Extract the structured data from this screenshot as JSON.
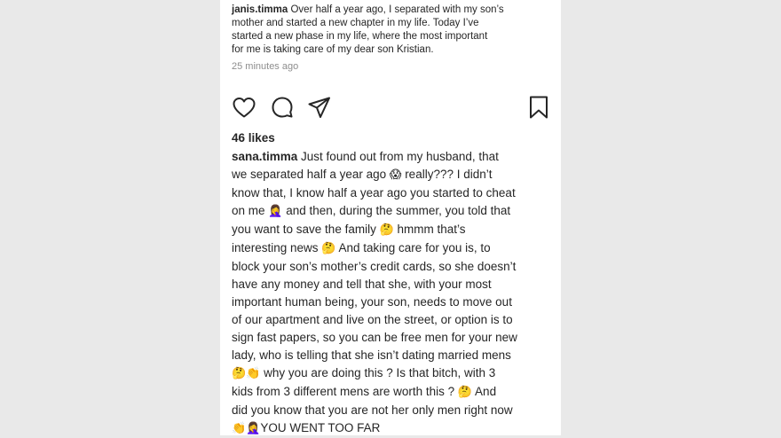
{
  "post": {
    "caption": {
      "username": "janis.timma",
      "text_lines": [
        "Over half a year ago, I separated with my son’s",
        "mother and started a new chapter in my life. Today I’ve",
        "started a new phase in my life, where the most important",
        "for me is taking care of my dear son Kristian."
      ],
      "timestamp": "25 minutes ago"
    },
    "actions": {
      "icons": [
        "heart-icon",
        "comment-icon",
        "share-icon",
        "bookmark-icon"
      ]
    },
    "likes": "46 likes",
    "comment": {
      "username": "sana.timma",
      "lines": [
        {
          "parts": [
            " Just found out from my husband, that"
          ]
        },
        {
          "parts": [
            "we separated half a year ago ",
            "😱",
            " really??? I didn’t"
          ]
        },
        {
          "parts": [
            "know that, I know half a year ago you started to cheat"
          ]
        },
        {
          "parts": [
            "on me ",
            "🤦‍♀",
            " and then, during the summer, you told that"
          ]
        },
        {
          "parts": [
            "you want to save the family ",
            "🤔",
            " hmmm that’s"
          ]
        },
        {
          "parts": [
            "interesting news ",
            "🤔",
            " And taking care for you is, to"
          ]
        },
        {
          "parts": [
            "block your son’s mother’s credit cards, so she doesn’t"
          ]
        },
        {
          "parts": [
            "have any money and tell that she, with your most"
          ]
        },
        {
          "parts": [
            "important human being, your son, needs to move out"
          ]
        },
        {
          "parts": [
            "of our apartment and live on the street, or option is to"
          ]
        },
        {
          "parts": [
            "sign fast papers, so you can be free men for your new"
          ]
        },
        {
          "parts": [
            "lady, who is telling that she isn’t dating married mens"
          ]
        },
        {
          "parts": [
            "🤔👏",
            " why you are doing this ? Is that bitch, with 3"
          ]
        },
        {
          "parts": [
            "kids from 3 different mens are worth this ? ",
            "🤔",
            " And"
          ]
        },
        {
          "parts": [
            "did you know that you are not her only men right now"
          ]
        },
        {
          "parts": [
            "👏🤦‍♀",
            "YOU WENT TOO FAR"
          ]
        }
      ]
    }
  },
  "colors": {
    "background": "#e9e9e9",
    "card": "#ffffff",
    "text": "#262626",
    "muted": "#8e8e8e"
  }
}
